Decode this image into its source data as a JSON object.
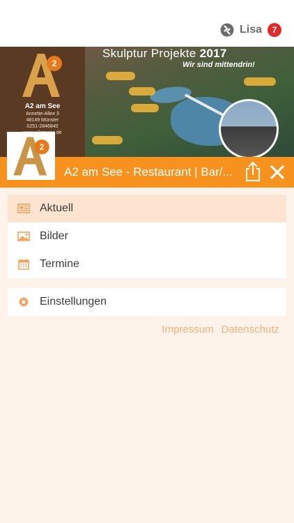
{
  "user": {
    "name": "Lisa",
    "badge_count": "7"
  },
  "banner": {
    "brand": "A2 am See",
    "address_line1": "Annette-Allee 3",
    "address_line2": "48149 Münster",
    "phone": "0251-2846840",
    "web": "www.a2amsee.de",
    "headline_prefix": "Skulptur Projekte ",
    "headline_year": "2017",
    "subline": "Wir sind mittendrin!"
  },
  "header": {
    "title": "A2 am See - Restaurant | Bar/..."
  },
  "menu": {
    "items": [
      {
        "label": "Aktuell",
        "icon": "newspaper-icon",
        "active": true
      },
      {
        "label": "Bilder",
        "icon": "image-icon",
        "active": false
      },
      {
        "label": "Termine",
        "icon": "calendar-icon",
        "active": false
      }
    ],
    "settings": {
      "label": "Einstellungen",
      "icon": "gear-icon"
    }
  },
  "footer_links": {
    "impressum": "Impressum",
    "datenschutz": "Datenschutz"
  },
  "colors": {
    "accent": "#f7921e",
    "active_bg": "#fde4d0",
    "page_bg": "#fdf3ea",
    "link": "#f5b07a",
    "badge": "#e02b2b"
  }
}
